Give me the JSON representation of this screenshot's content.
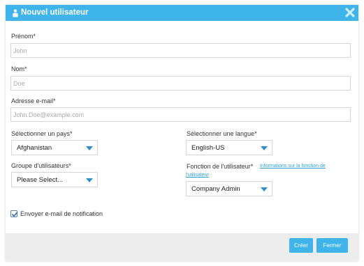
{
  "header": {
    "title": "Nouvel utilisateur",
    "icon": "user-icon",
    "close_icon": "close-icon",
    "color": "#3eb4ea"
  },
  "form": {
    "first_name": {
      "label": "Prénom*",
      "placeholder": "John",
      "value": ""
    },
    "last_name": {
      "label": "Nom*",
      "placeholder": "Doe",
      "value": ""
    },
    "email": {
      "label": "Adresse e-mail*",
      "placeholder": "John.Doe@example.com",
      "value": ""
    },
    "country": {
      "label": "Sélectionner un pays*",
      "value": "Afghanistan"
    },
    "language": {
      "label": "Sélectionner une langue*",
      "value": "English-US"
    },
    "user_group": {
      "label": "Groupe d'utilisateurs*",
      "value": "Please Select..."
    },
    "user_role": {
      "label": "Fonction de l'utilisateur*",
      "info_link": "Informations sur la fonction de l'utilisateur",
      "value": "Company Admin"
    },
    "notify": {
      "label": "Envoyer e-mail de notification",
      "checked": true
    }
  },
  "footer": {
    "create_label": "Créer",
    "close_label": "Fermer"
  }
}
